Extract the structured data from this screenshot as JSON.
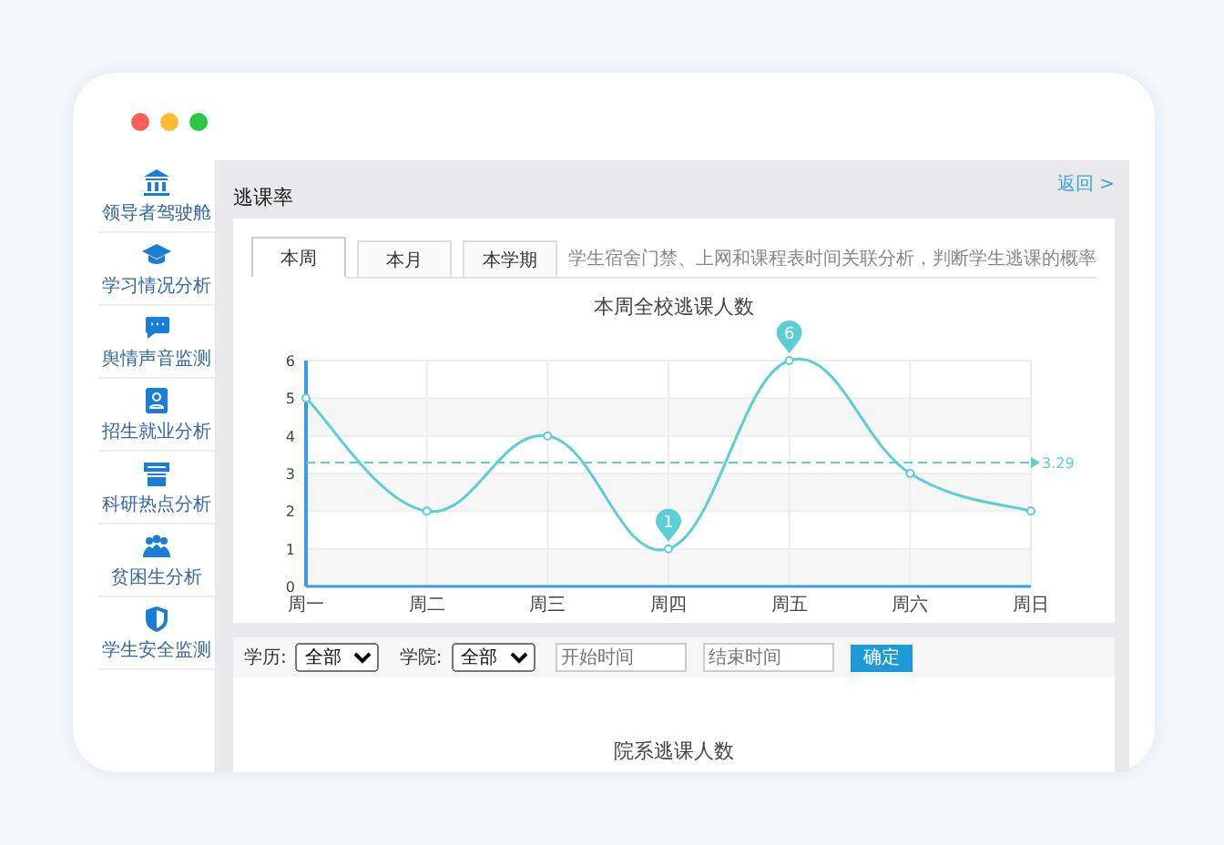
{
  "window": {
    "controls": [
      {
        "color": "#ff5f57"
      },
      {
        "color": "#febc2e"
      },
      {
        "color": "#28c840"
      }
    ]
  },
  "sidebar": {
    "items": [
      {
        "label": "领导者驾驶舱"
      },
      {
        "label": "学习情况分析"
      },
      {
        "label": "舆情声音监测"
      },
      {
        "label": "招生就业分析"
      },
      {
        "label": "科研热点分析"
      },
      {
        "label": "贫困生分析"
      },
      {
        "label": "学生安全监测"
      }
    ]
  },
  "page": {
    "title": "逃课率",
    "back_link": "返回 >",
    "tabs": [
      {
        "label": "本周",
        "selected": true
      },
      {
        "label": "本月",
        "selected": false
      },
      {
        "label": "本学期",
        "selected": false
      }
    ],
    "description": "学生宿舍门禁、上网和课程表时间关联分析，判断学生逃课的概率",
    "chart_data": {
      "type": "line",
      "title": "本周全校逃课人数",
      "categories": [
        "周一",
        "周二",
        "周三",
        "周四",
        "周五",
        "周六",
        "周日"
      ],
      "series": [
        {
          "color": "#5ccfd6",
          "marker": "circle",
          "values": [
            5,
            2,
            4,
            1,
            6,
            3,
            2
          ]
        }
      ],
      "ylim": [
        0,
        6
      ],
      "yticks": [
        0,
        1,
        2,
        3,
        4,
        5,
        6
      ],
      "grid": true,
      "annotations": [
        {
          "text": "6",
          "x": "周五",
          "y": 6
        },
        {
          "text": "1",
          "x": "周四",
          "y": 1
        }
      ],
      "ref_lines": [
        {
          "axis": "y",
          "value": 3.29,
          "label": "3.29"
        }
      ]
    },
    "filters": [
      {
        "label": "学历:",
        "value": "全部"
      },
      {
        "label": "学院:",
        "value": "全部"
      }
    ],
    "date_fields": [
      {
        "placeholder": "开始时间"
      },
      {
        "placeholder": "结束时间"
      }
    ],
    "confirm_button": "确定",
    "section_title": "院系逃课人数"
  }
}
